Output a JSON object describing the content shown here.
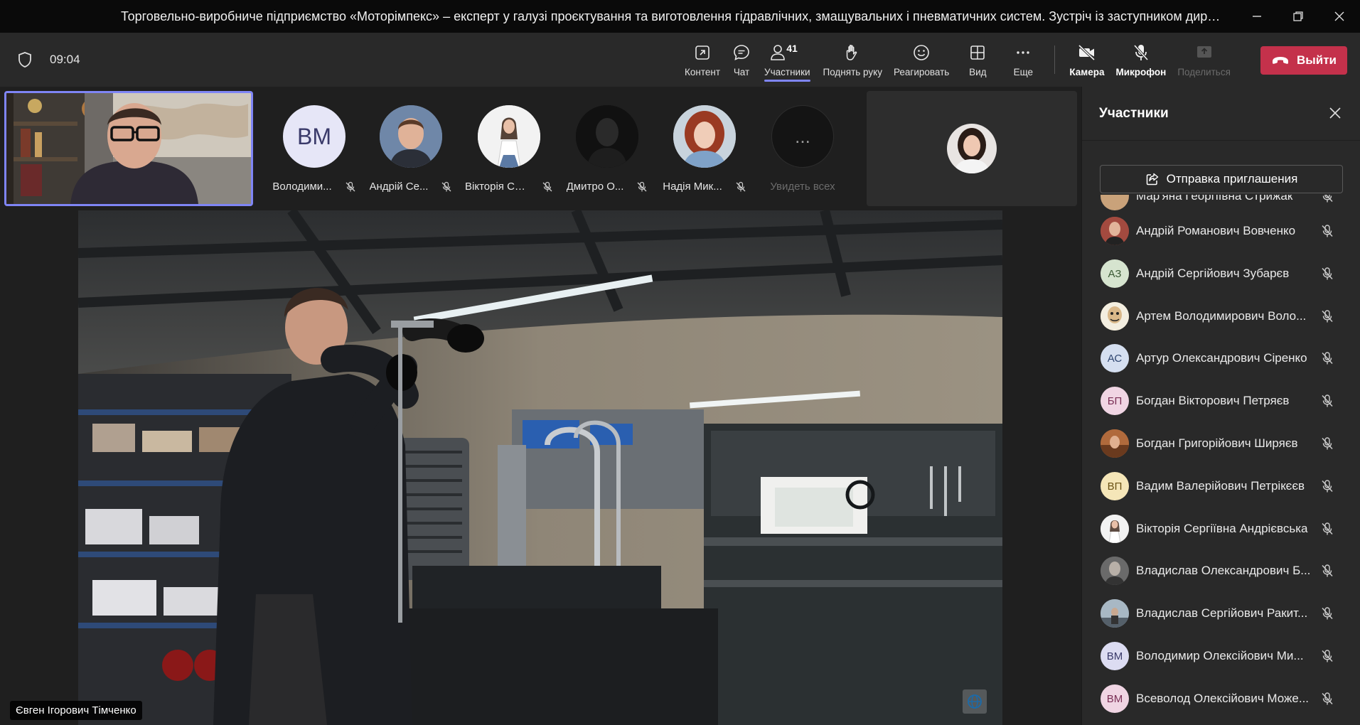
{
  "window": {
    "title": "Торговельно-виробниче підприємство «Моторімпекс» – експерт у галузі проєктування та виготовлення гідравлічних, змащувальних і пневматичних систем. Зустріч із заступником директора ...",
    "minimize_icon": "minimize-icon",
    "maximize_icon": "restore-icon",
    "close_icon": "close-icon"
  },
  "meeting": {
    "timer": "09:04"
  },
  "toolbar": {
    "content": "Контент",
    "chat": "Чат",
    "participants": "Участники",
    "participants_count": "41",
    "raise_hand": "Поднять руку",
    "react": "Реагировать",
    "view": "Вид",
    "more": "Еще",
    "camera": "Камера",
    "microphone": "Микрофон",
    "share": "Поделиться",
    "leave": "Выйти"
  },
  "strip": {
    "thumbs": [
      {
        "initials": "ВМ",
        "name": "Володими...",
        "avatar_color": "#e6e6f7"
      },
      {
        "initials": "",
        "name": "Андрій Се...",
        "avatar_color": "#6f87a8"
      },
      {
        "initials": "",
        "name": "Вікторія Се...",
        "avatar_color": "#f2f2f2"
      },
      {
        "initials": "",
        "name": "Дмитро О...",
        "avatar_color": "#111111"
      },
      {
        "initials": "",
        "name": "Надія Мик...",
        "avatar_color": "#c8d3dc"
      }
    ],
    "see_all": "Увидеть всех",
    "see_all_icon": "..."
  },
  "stage": {
    "speaker_name": "Євген Ігорович Тімченко"
  },
  "panel": {
    "title": "Участники",
    "invite": "Отправка приглашения",
    "participants": [
      {
        "name": "Мар'яна Георгіївна Стрижак",
        "initials": "",
        "color": "#c9a27a"
      },
      {
        "name": "Андрій Романович Вовченко",
        "initials": "",
        "color": "#a34a3f"
      },
      {
        "name": "Андрій Сергійович Зубарєв",
        "initials": "АЗ",
        "color": "#d6e4cf"
      },
      {
        "name": "Артем Володимирович Воло...",
        "initials": "",
        "color": "#e8d9a8"
      },
      {
        "name": "Артур Олександрович Сіренко",
        "initials": "АС",
        "color": "#d5dff0"
      },
      {
        "name": "Богдан Вікторович Петряєв",
        "initials": "БП",
        "color": "#f0d5e3"
      },
      {
        "name": "Богдан Григорійович Ширяєв",
        "initials": "",
        "color": "#b06a3c"
      },
      {
        "name": "Вадим Валерійович Петрікєєв",
        "initials": "ВП",
        "color": "#f5e6b8"
      },
      {
        "name": "Вікторія Сергіївна Андрієвська",
        "initials": "",
        "color": "#efe5e0"
      },
      {
        "name": "Владислав Олександрович Б...",
        "initials": "",
        "color": "#5d5d5d"
      },
      {
        "name": "Владислав Сергійович Ракит...",
        "initials": "",
        "color": "#7d8a94"
      },
      {
        "name": "Володимир Олексійович Ми...",
        "initials": "ВМ",
        "color": "#dcdcf2"
      },
      {
        "name": "Всеволод Олексійович Може...",
        "initials": "ВМ",
        "color": "#f0d5e3"
      }
    ]
  }
}
